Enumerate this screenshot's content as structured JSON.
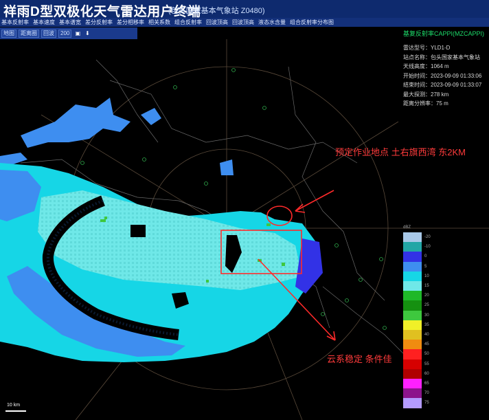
{
  "window": {
    "title": "祥雨D型双极化天气雷达用户终端",
    "subtitle": "(包头国家基本气象站 Z0480)"
  },
  "menu": {
    "items": [
      "基本反射率",
      "基本速度",
      "基本谱宽",
      "差分反射率",
      "差分相移率",
      "相关系数",
      "组合反射率",
      "回波顶高",
      "回波顶高",
      "液态水含量",
      "组合反射率分布图"
    ]
  },
  "toolbar": {
    "mode_select": "地图",
    "scale_select": "距离圈",
    "layer_select": "回波",
    "range_select": "200"
  },
  "info_panel": {
    "header": "基复反射率CAPPI(MZCAPPI)",
    "rows": [
      "雷达型号：YLD1-D",
      "站点名称：包头国家基本气象站",
      "天线高度：1064 m",
      "开始时间：2023-09-09 01:33:06",
      "结束时间：2023-09-09 01:33:07",
      "最大探测：278 km",
      "距离分辨率：75 m"
    ]
  },
  "legend": {
    "title": "dBZ",
    "colors": [
      "#a8c8e8",
      "#22a6a6",
      "#3232e6",
      "#3e8ef0",
      "#16d6e6",
      "#6fe8e8",
      "#1fb829",
      "#159010",
      "#3ec83e",
      "#f0f028",
      "#e0c020",
      "#f08c10",
      "#ff2020",
      "#d60000",
      "#b00000",
      "#ff20ff",
      "#8c148c",
      "#b49bff"
    ],
    "labels": [
      "-20",
      "-10",
      "0",
      "5",
      "10",
      "15",
      "20",
      "25",
      "30",
      "35",
      "40",
      "45",
      "50",
      "55",
      "60",
      "65",
      "70",
      "75"
    ]
  },
  "annotations": {
    "site_text": "预定作业地点 土右旗西湾 东2KM",
    "cloud_text": "云系稳定  条件佳",
    "color": "#ff2a2a"
  },
  "scale_bar": {
    "label": "10 km"
  }
}
